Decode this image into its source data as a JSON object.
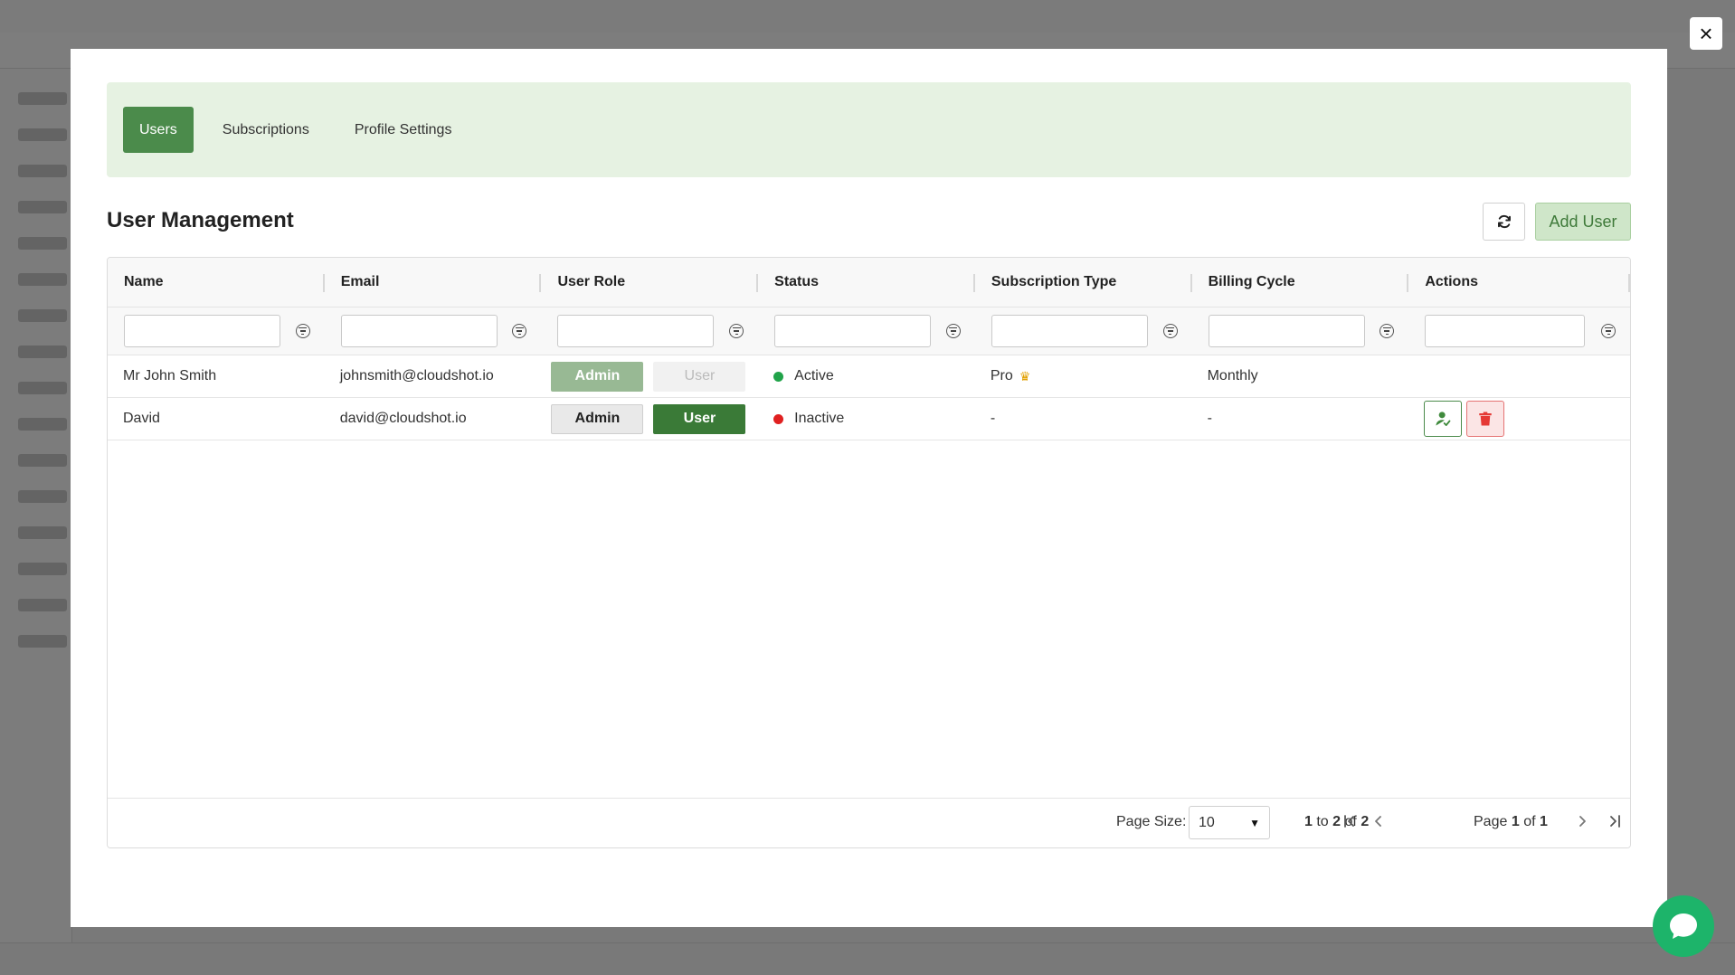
{
  "tabs": [
    {
      "label": "Users",
      "active": true
    },
    {
      "label": "Subscriptions",
      "active": false
    },
    {
      "label": "Profile Settings",
      "active": false
    }
  ],
  "page_title": "User Management",
  "add_user_label": "Add User",
  "close_label": "×",
  "columns": [
    "Name",
    "Email",
    "User Role",
    "Status",
    "Subscription Type",
    "Billing Cycle",
    "Actions"
  ],
  "rows": [
    {
      "name": "Mr John Smith",
      "email": "johnsmith@cloudshot.io",
      "role_admin": "Admin",
      "role_user": "User",
      "role_selected": "Admin",
      "status": "Active",
      "status_color": "#21a34a",
      "subscription": "Pro",
      "subscription_icon": "crown-icon",
      "billing": "Monthly"
    },
    {
      "name": "David",
      "email": "david@cloudshot.io",
      "role_admin": "Admin",
      "role_user": "User",
      "role_selected": "User",
      "status": "Inactive",
      "status_color": "#e02020",
      "subscription": "-",
      "billing": "-",
      "actions": [
        "approve-user-icon",
        "trash-icon"
      ]
    }
  ],
  "footer": {
    "page_size_label": "Page Size:",
    "page_size_value": "10",
    "range_from": "1",
    "range_to": "2",
    "range_total": "2",
    "range_to_word": "to",
    "range_of_word": "of",
    "page_word": "Page",
    "page_current": "1",
    "page_of_word": "of",
    "page_total": "1"
  },
  "colors": {
    "accent": "#4b8b4b",
    "tabs_bg": "#e6f2e2",
    "chat": "#1db46a"
  }
}
